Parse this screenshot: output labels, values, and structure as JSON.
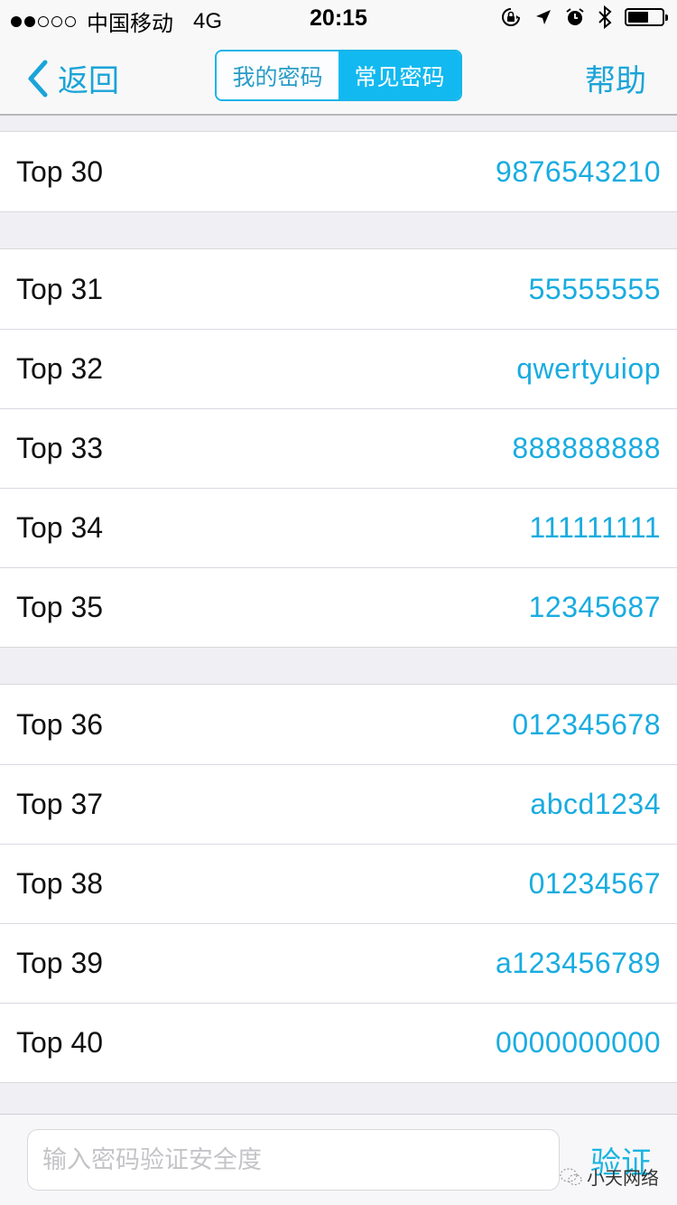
{
  "status_bar": {
    "signal_bars_filled": 2,
    "signal_bars_total": 5,
    "carrier": "中国移动",
    "network": "4G",
    "time": "20:15",
    "icons": [
      "rotation-lock-icon",
      "location-arrow-icon",
      "alarm-icon",
      "bluetooth-icon",
      "battery-icon"
    ],
    "battery_level": 0.6
  },
  "nav": {
    "back_label": "返回",
    "segments": [
      {
        "label": "我的密码",
        "active": false
      },
      {
        "label": "常见密码",
        "active": true
      }
    ],
    "help_label": "帮助"
  },
  "groups": [
    {
      "rows": [
        {
          "label": "Top 30",
          "value": "9876543210"
        }
      ]
    },
    {
      "rows": [
        {
          "label": "Top 31",
          "value": "55555555"
        },
        {
          "label": "Top 32",
          "value": "qwertyuiop"
        },
        {
          "label": "Top 33",
          "value": "888888888"
        },
        {
          "label": "Top 34",
          "value": "111111111"
        },
        {
          "label": "Top 35",
          "value": "12345687"
        }
      ]
    },
    {
      "rows": [
        {
          "label": "Top 36",
          "value": "012345678"
        },
        {
          "label": "Top 37",
          "value": "abcd1234"
        },
        {
          "label": "Top 38",
          "value": "01234567"
        },
        {
          "label": "Top 39",
          "value": "a123456789"
        },
        {
          "label": "Top 40",
          "value": "0000000000"
        }
      ]
    }
  ],
  "bottom": {
    "input_value": "",
    "input_placeholder": "输入密码验证安全度",
    "verify_label": "验证",
    "watermark_text": "小天网络"
  },
  "colors": {
    "accent": "#19ace0",
    "segment_active_bg": "#12b9f0",
    "background": "#efeff4"
  }
}
